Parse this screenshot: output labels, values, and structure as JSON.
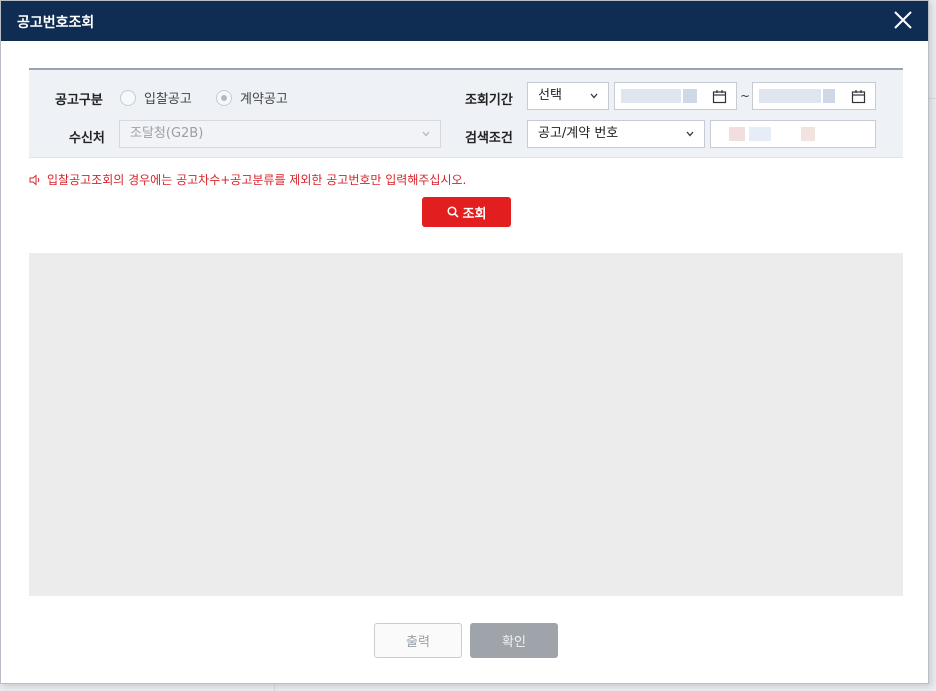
{
  "dialog": {
    "title": "공고번호조회"
  },
  "filters": {
    "notice_type": {
      "label": "공고구분",
      "options": [
        "입찰공고",
        "계약공고"
      ],
      "selected": "계약공고"
    },
    "recipient": {
      "label": "수신처",
      "value": "조달청(G2B)"
    },
    "period": {
      "label": "조회기간",
      "select_value": "선택",
      "tilde": "~"
    },
    "search_condition": {
      "label": "검색조건",
      "select_value": "공고/계약 번호"
    }
  },
  "notice": {
    "text": "입찰공고조회의 경우에는 공고차수+공고분류를 제외한 공고번호만 입력해주십시오."
  },
  "buttons": {
    "search": "조회",
    "print": "출력",
    "confirm": "확인"
  },
  "colors": {
    "titlebar": "#0f2c52",
    "accent_red": "#e21e1e",
    "notice_red": "#d8232a"
  }
}
